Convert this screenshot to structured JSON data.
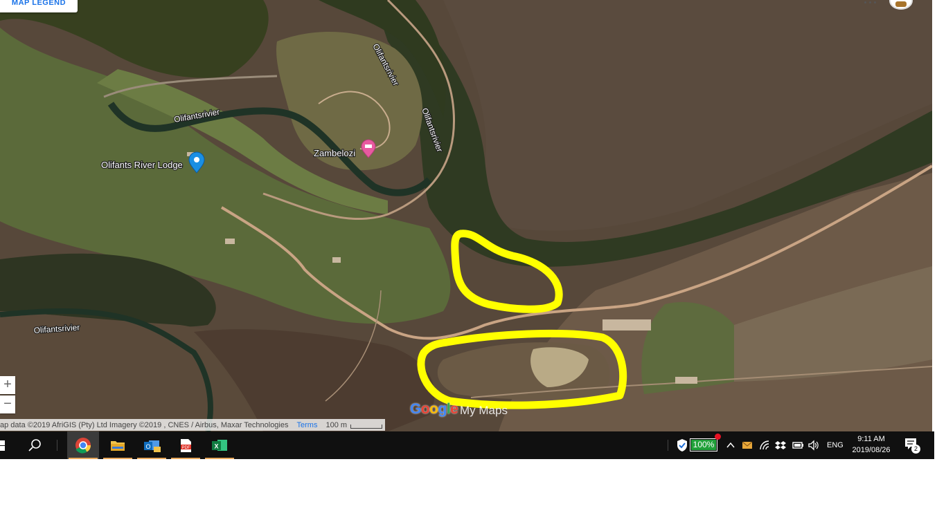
{
  "map": {
    "legend_button": "MAP LEGEND",
    "labels": {
      "river_1": "Olifantsrivier",
      "river_2": "Olifantsrivier",
      "river_3": "Olifantsrivier",
      "river_4": "Olifantsrivier",
      "lodge": "Olifants River Lodge",
      "zambelozi": "Zambelozi"
    },
    "zoom_in": "+",
    "zoom_out": "−",
    "attribution": "ap data ©2019 AfriGIS (Pty) Ltd Imagery ©2019 , CNES / Airbus, Maxar Technologies",
    "terms_link": "Terms",
    "scale_label": "100 m",
    "logo_letters": [
      "G",
      "o",
      "o",
      "g",
      "l",
      "e"
    ],
    "logo_colors": [
      "#4285f4",
      "#ea4335",
      "#fbbc05",
      "#4285f4",
      "#34a853",
      "#ea4335"
    ],
    "mymaps_label": "My Maps",
    "highlight_color": "#ffff00",
    "pin_colors": {
      "lodge": "#1a8fe3",
      "zambelozi": "#e85aa0"
    }
  },
  "taskbar": {
    "apps": [
      {
        "name": "windows-start",
        "icon": "windows-logo-icon"
      },
      {
        "name": "search",
        "icon": "search-icon"
      },
      {
        "name": "chrome",
        "icon": "chrome-icon"
      },
      {
        "name": "file-explorer",
        "icon": "folder-icon"
      },
      {
        "name": "outlook",
        "icon": "outlook-icon"
      },
      {
        "name": "pdf-reader",
        "icon": "pdf-icon"
      },
      {
        "name": "excel",
        "icon": "excel-icon"
      }
    ],
    "battery_percent": "100%",
    "battery_level": 1.0,
    "language": "ENG",
    "time": "9:11 AM",
    "date": "2019/08/26",
    "notification_count": "2"
  }
}
